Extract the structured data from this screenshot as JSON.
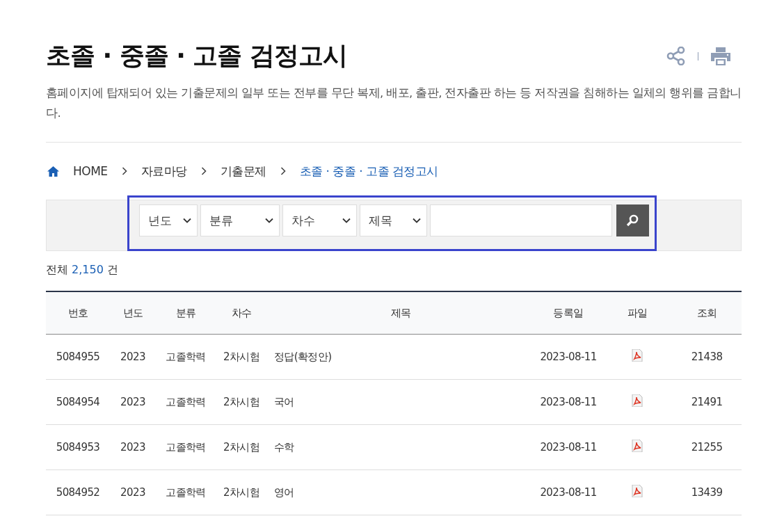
{
  "title": "초졸 · 중졸 · 고졸 검정고시",
  "notice": "홈페이지에 탑재되어 있는 기출문제의 일부 또는 전부를 무단 복제, 배포, 출판, 전자출판 하는 등 저작권을 침해하는 일체의 행위를 금합니다.",
  "breadcrumb": [
    {
      "label": "HOME",
      "selected": false
    },
    {
      "label": "자료마당",
      "selected": false
    },
    {
      "label": "기출문제",
      "selected": false
    },
    {
      "label": "초졸 · 중졸 · 고졸 검정고시",
      "selected": true
    }
  ],
  "search": {
    "filters": [
      "년도",
      "분류",
      "차수",
      "제목"
    ]
  },
  "count": {
    "prefix": "전체",
    "value": "2,150",
    "suffix": "건"
  },
  "table": {
    "columns": [
      "번호",
      "년도",
      "분류",
      "차수",
      "제목",
      "등록일",
      "파일",
      "조회"
    ],
    "rows": [
      {
        "number": "5084955",
        "year": "2023",
        "category": "고졸학력",
        "round": "2차시험",
        "subject": "정답(확정안)",
        "date": "2023-08-11",
        "views": "21438"
      },
      {
        "number": "5084954",
        "year": "2023",
        "category": "고졸학력",
        "round": "2차시험",
        "subject": "국어",
        "date": "2023-08-11",
        "views": "21491"
      },
      {
        "number": "5084953",
        "year": "2023",
        "category": "고졸학력",
        "round": "2차시험",
        "subject": "수학",
        "date": "2023-08-11",
        "views": "21255"
      },
      {
        "number": "5084952",
        "year": "2023",
        "category": "고졸학력",
        "round": "2차시험",
        "subject": "영어",
        "date": "2023-08-11",
        "views": "13439"
      }
    ]
  }
}
